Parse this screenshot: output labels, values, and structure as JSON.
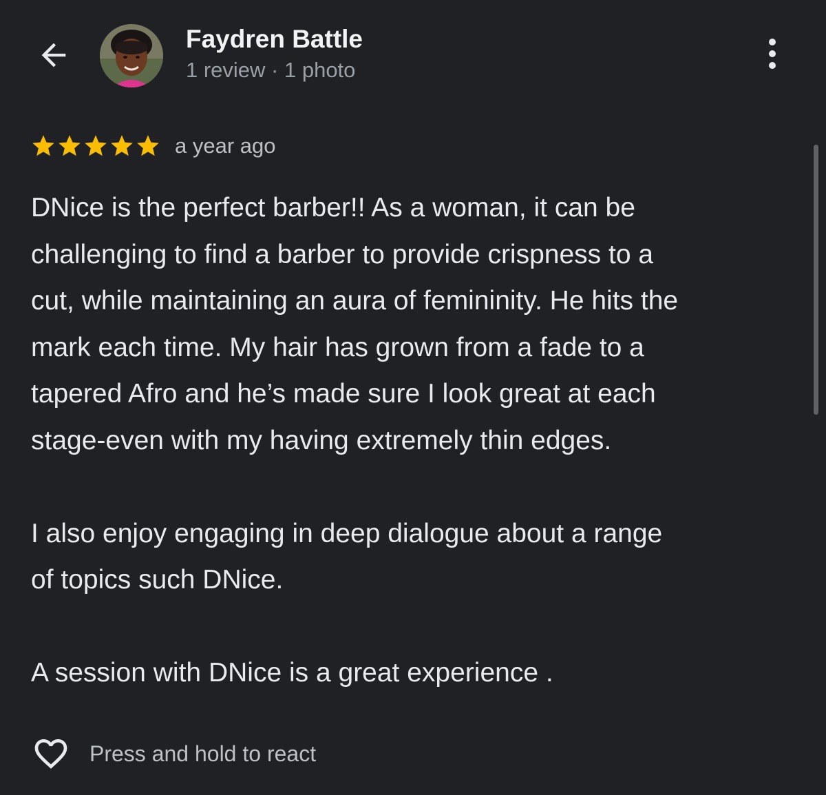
{
  "header": {
    "back_icon": "arrow-left-icon",
    "reviewer_name": "Faydren Battle",
    "reviewer_meta": "1 review · 1 photo",
    "more_icon": "more-vertical-icon"
  },
  "review": {
    "rating": 5,
    "rating_max": 5,
    "star_color": "#fbbc04",
    "time": "a year ago",
    "lines": [
      "DNice is the perfect barber!! As a woman, it can be",
      "challenging to find a barber to provide crispness to a",
      "cut, while maintaining an aura of femininity. He hits the",
      "mark each time. My hair has grown from a fade to a",
      "tapered Afro and he’s made sure I look great at each",
      "stage-even with my having extremely thin edges.",
      "I also enjoy engaging in deep dialogue about a range",
      "of topics such DNice.",
      "A session with DNice is a great experience ."
    ]
  },
  "react": {
    "icon": "heart-outline-icon",
    "label": "Press and hold to react"
  },
  "colors": {
    "background": "#202124",
    "text_primary": "#e8eaed",
    "text_secondary": "#9aa0a6",
    "star": "#fbbc04"
  }
}
